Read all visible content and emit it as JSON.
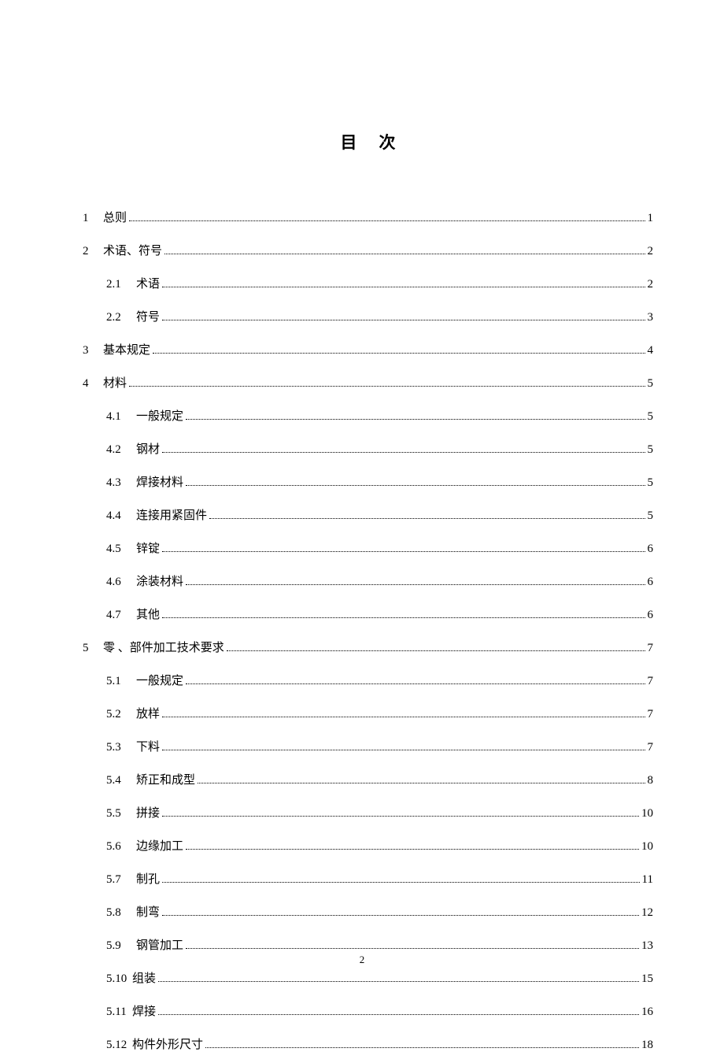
{
  "title": "目次",
  "footer_page": "2",
  "entries": [
    {
      "level": 0,
      "num": "1",
      "label": "总则",
      "page": "1"
    },
    {
      "level": 0,
      "num": "2",
      "label": "术语、符号",
      "page": "2"
    },
    {
      "level": 1,
      "num": "2.1",
      "label": "术语",
      "page": "2"
    },
    {
      "level": 1,
      "num": "2.2",
      "label": "符号",
      "page": "3"
    },
    {
      "level": 0,
      "num": "3",
      "label": "基本规定",
      "page": "4"
    },
    {
      "level": 0,
      "num": "4",
      "label": "材料",
      "page": "5"
    },
    {
      "level": 1,
      "num": "4.1",
      "label": "一般规定",
      "page": "5"
    },
    {
      "level": 1,
      "num": "4.2",
      "label": "钢材",
      "page": "5"
    },
    {
      "level": 1,
      "num": "4.3",
      "label": "焊接材料",
      "page": "5"
    },
    {
      "level": 1,
      "num": "4.4",
      "label": "连接用紧固件",
      "page": "5"
    },
    {
      "level": 1,
      "num": "4.5",
      "label": "锌锭",
      "page": "6"
    },
    {
      "level": 1,
      "num": "4.6",
      "label": "涂装材料",
      "page": "6"
    },
    {
      "level": 1,
      "num": "4.7",
      "label": "其他",
      "page": "6"
    },
    {
      "level": 0,
      "num": "5",
      "label": "零 、部件加工技术要求",
      "page": "7"
    },
    {
      "level": 1,
      "num": "5.1",
      "label": "一般规定",
      "page": "7"
    },
    {
      "level": 1,
      "num": "5.2",
      "label": "放样",
      "page": "7"
    },
    {
      "level": 1,
      "num": "5.3",
      "label": "下料",
      "page": "7"
    },
    {
      "level": 1,
      "num": "5.4",
      "label": "矫正和成型",
      "page": "8"
    },
    {
      "level": 1,
      "num": "5.5",
      "label": "拼接",
      "page": "10"
    },
    {
      "level": 1,
      "num": "5.6",
      "label": "边缘加工",
      "page": "10"
    },
    {
      "level": 1,
      "num": "5.7",
      "label": "制孔",
      "page": "11"
    },
    {
      "level": 1,
      "num": "5.8",
      "label": "制弯",
      "page": "12"
    },
    {
      "level": 1,
      "num": "5.9",
      "label": "钢管加工",
      "page": "13"
    },
    {
      "level": 2,
      "num": "5.10",
      "label": "组装",
      "page": "15"
    },
    {
      "level": 2,
      "num": "5.11",
      "label": "焊接",
      "page": "16"
    },
    {
      "level": 2,
      "num": "5.12",
      "label": "构件外形尺寸",
      "page": "18"
    }
  ]
}
